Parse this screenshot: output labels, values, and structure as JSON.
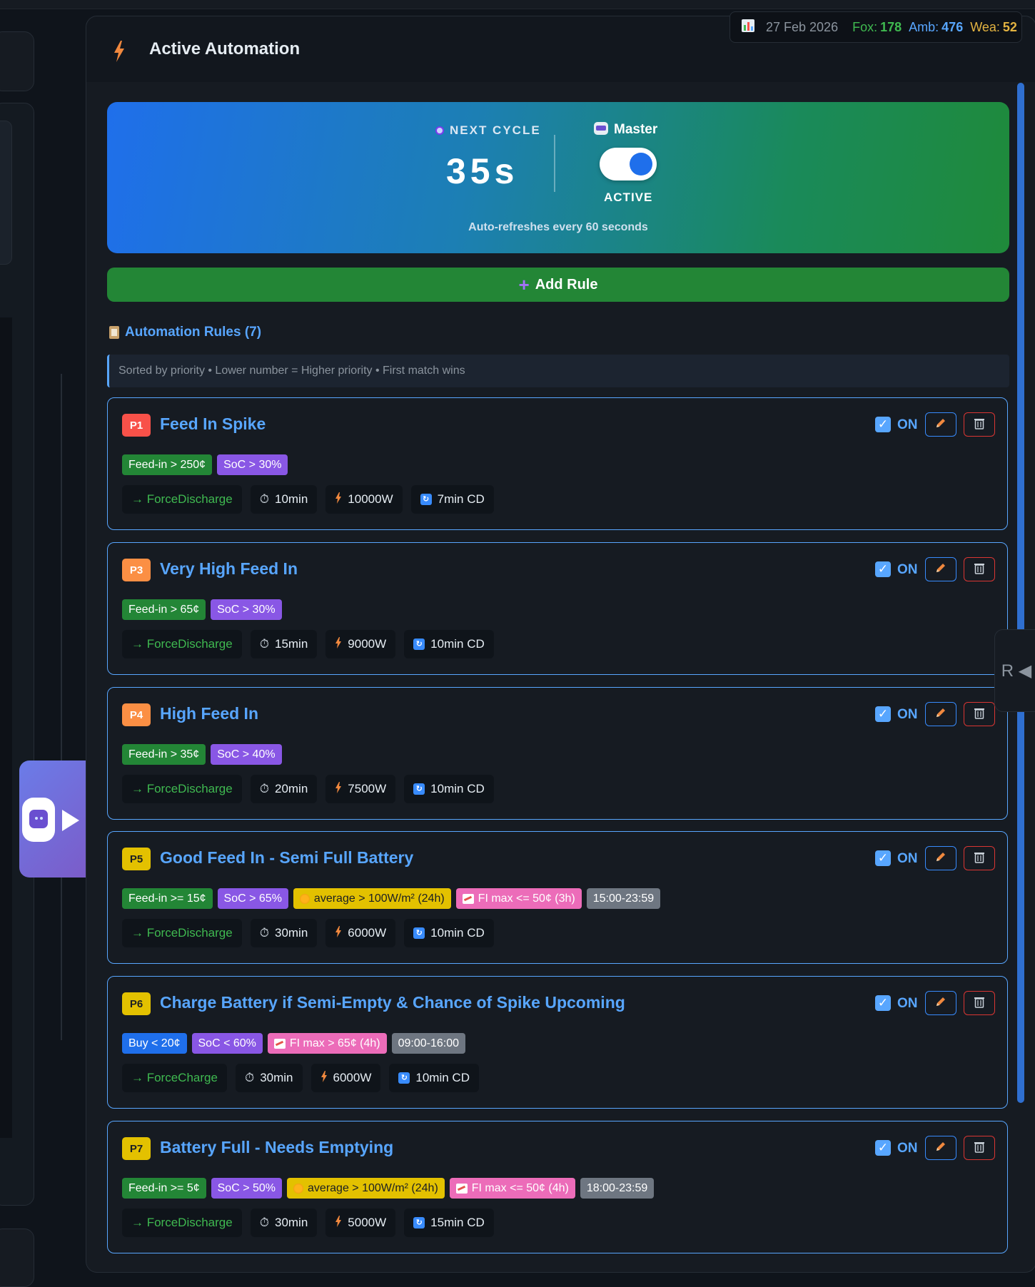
{
  "header": {
    "title": "Active Automation"
  },
  "stats": {
    "date": "27 Feb 2026",
    "fox_label": "Fox:",
    "fox_value": "178",
    "amb_label": "Amb:",
    "amb_value": "476",
    "wea_label": "Wea:",
    "wea_value": "52"
  },
  "hero": {
    "next_cycle_label": "NEXT CYCLE",
    "next_cycle_value": "35s",
    "master_label": "Master",
    "master_state": "ACTIVE",
    "master_on": true,
    "refresh_text": "Auto-refreshes every 60 seconds"
  },
  "add_rule_label": "Add Rule",
  "rules_header": "Automation Rules (7)",
  "info_text": "Sorted by priority • Lower number = Higher priority • First match wins",
  "side_tab_label": "R ◀",
  "colors": {
    "accent": "#58a6ff",
    "green": "#238636",
    "purple": "#8957e5",
    "danger": "#da3633"
  },
  "rules": [
    {
      "priority": "P1",
      "badge_color": "#f85149",
      "title": "Feed In Spike",
      "enabled_label": "ON",
      "conditions": [
        {
          "text": "Feed-in > 250¢",
          "style": "green"
        },
        {
          "text": "SoC > 30%",
          "style": "purple"
        }
      ],
      "action": "→ ForceDischarge",
      "duration": "10min",
      "power": "10000W",
      "cooldown": "7min CD"
    },
    {
      "priority": "P3",
      "badge_color": "#fb8f44",
      "title": "Very High Feed In",
      "enabled_label": "ON",
      "conditions": [
        {
          "text": "Feed-in > 65¢",
          "style": "green"
        },
        {
          "text": "SoC > 30%",
          "style": "purple"
        }
      ],
      "action": "→ ForceDischarge",
      "duration": "15min",
      "power": "9000W",
      "cooldown": "10min CD"
    },
    {
      "priority": "P4",
      "badge_color": "#fb8f44",
      "title": "High Feed In",
      "enabled_label": "ON",
      "conditions": [
        {
          "text": "Feed-in > 35¢",
          "style": "green"
        },
        {
          "text": "SoC > 40%",
          "style": "purple"
        }
      ],
      "action": "→ ForceDischarge",
      "duration": "20min",
      "power": "7500W",
      "cooldown": "10min CD"
    },
    {
      "priority": "P5",
      "badge_color": "#e3c100",
      "title": "Good Feed In - Semi Full Battery",
      "enabled_label": "ON",
      "conditions": [
        {
          "text": "Feed-in >= 15¢",
          "style": "green"
        },
        {
          "text": "SoC > 65%",
          "style": "purple"
        },
        {
          "text": "average > 100W/m² (24h)",
          "style": "yellow",
          "icon": "sun-icon"
        },
        {
          "text": "FI max <= 50¢ (3h)",
          "style": "pink",
          "icon": "chart-icon"
        },
        {
          "text": "15:00-23:59",
          "style": "gray"
        }
      ],
      "action": "→ ForceDischarge",
      "duration": "30min",
      "power": "6000W",
      "cooldown": "10min CD"
    },
    {
      "priority": "P6",
      "badge_color": "#e3c100",
      "title": "Charge Battery if Semi-Empty & Chance of Spike Upcoming",
      "enabled_label": "ON",
      "conditions": [
        {
          "text": "Buy < 20¢",
          "style": "blue"
        },
        {
          "text": "SoC < 60%",
          "style": "purple"
        },
        {
          "text": "FI max > 65¢ (4h)",
          "style": "pink",
          "icon": "chart-icon"
        },
        {
          "text": "09:00-16:00",
          "style": "gray"
        }
      ],
      "action": "→ ForceCharge",
      "duration": "30min",
      "power": "6000W",
      "cooldown": "10min CD"
    },
    {
      "priority": "P7",
      "badge_color": "#e3c100",
      "title": "Battery Full - Needs Emptying",
      "enabled_label": "ON",
      "conditions": [
        {
          "text": "Feed-in >= 5¢",
          "style": "green"
        },
        {
          "text": "SoC > 50%",
          "style": "purple"
        },
        {
          "text": "average > 100W/m² (24h)",
          "style": "yellow",
          "icon": "sun-icon"
        },
        {
          "text": "FI max <= 50¢ (4h)",
          "style": "pink",
          "icon": "chart-icon"
        },
        {
          "text": "18:00-23:59",
          "style": "gray"
        }
      ],
      "action": "→ ForceDischarge",
      "duration": "30min",
      "power": "5000W",
      "cooldown": "15min CD"
    }
  ]
}
